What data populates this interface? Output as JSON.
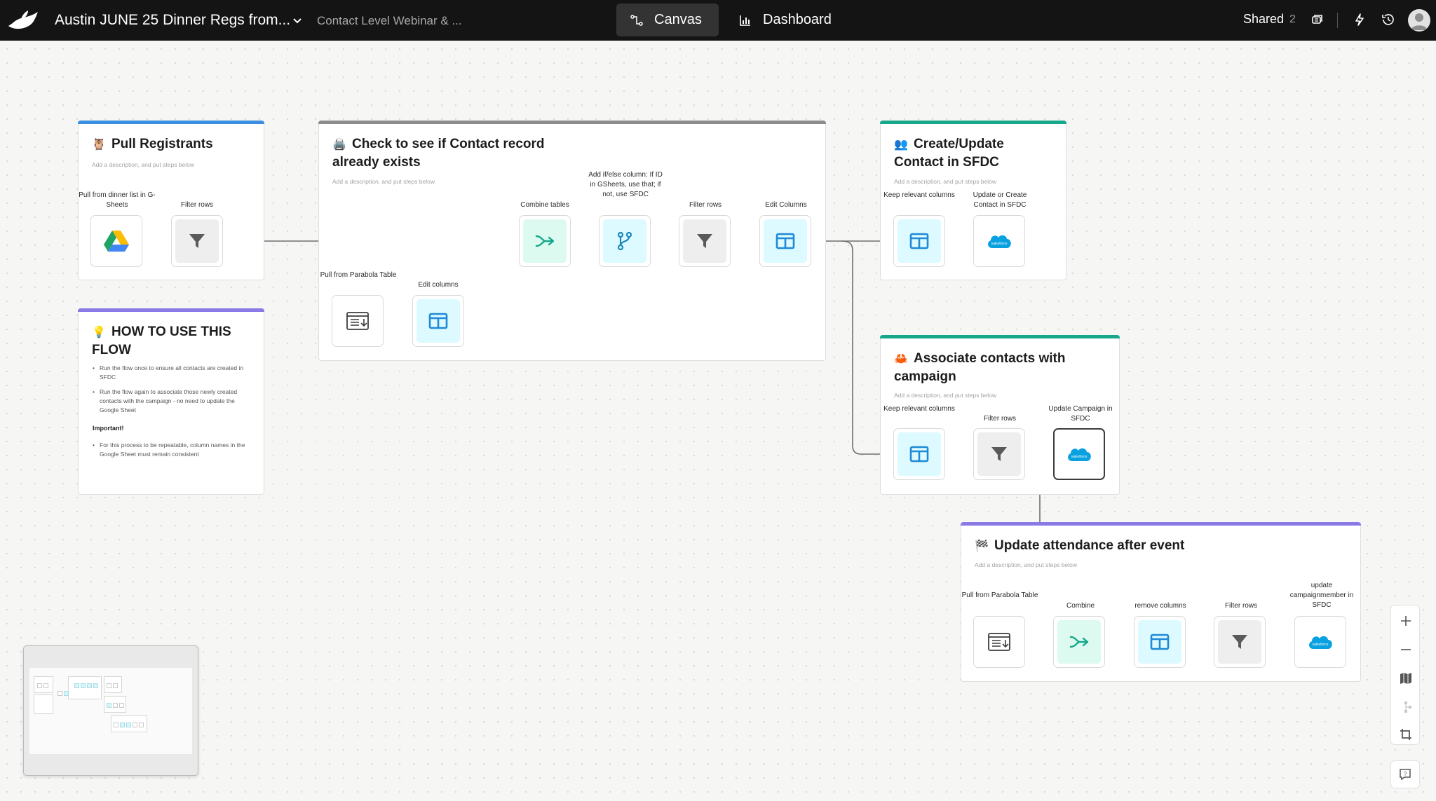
{
  "app": {
    "flow_title": "Austin JUNE 25 Dinner Regs from...",
    "flow_subtitle": "Contact Level Webinar & ...",
    "tabs": [
      {
        "label": "Canvas",
        "active": true
      },
      {
        "label": "Dashboard",
        "active": false
      }
    ],
    "shared_label": "Shared",
    "shared_count": "2",
    "colors": {
      "topbar": "#141414",
      "blue": "#3b8fe0",
      "purple": "#8a7ae6",
      "teal": "#17a88c",
      "gray": "#8c8c8c"
    }
  },
  "groups": {
    "pull": {
      "emoji": "🦉",
      "title": "Pull Registrants",
      "description": "Add a description, and put steps below",
      "steps": [
        "Pull from dinner list in G-Sheets",
        "Filter rows"
      ]
    },
    "howto": {
      "emoji": "💡",
      "title": "HOW TO USE THIS FLOW",
      "bullets": [
        "Run the flow once to ensure all contacts are created in SFDC",
        "Run the flow again to associate those newly created contacts with the campaign - no need to update the Google Sheet"
      ],
      "important_label": "Important!",
      "important_bullets": [
        "For this process to be repeatable, column names in the Google Sheet must remain consistent"
      ]
    },
    "check": {
      "emoji": "🖨️",
      "title": "Check to see if Contact record already exists",
      "description": "Add a description, and put steps below",
      "steps": [
        "Combine tables",
        "Add if/else column: If ID in GSheets, use that; if not, use SFDC",
        "Filter rows",
        "Edit Columns",
        "Pull from Parabola Table",
        "Edit columns"
      ]
    },
    "create": {
      "emoji": "👥",
      "title": "Create/Update Contact in SFDC",
      "description": "Add a description, and put steps below",
      "steps": [
        "Keep relevant columns",
        "Update or Create Contact in SFDC"
      ]
    },
    "associate": {
      "emoji": "🦀",
      "title": "Associate contacts with campaign",
      "description": "Add a description, and put steps below",
      "steps": [
        "Keep relevant columns",
        "Filter rows",
        "Update Campaign in SFDC"
      ]
    },
    "attendance": {
      "emoji": "🏁",
      "title": "Update attendance after event",
      "description": "Add a description, and put steps below",
      "steps": [
        "Pull from Parabola Table",
        "Combine",
        "remove columns",
        "Filter rows",
        "update campaignmember in SFDC"
      ]
    }
  },
  "icons": {
    "gsheets": "google-drive-icon",
    "filter": "filter-icon",
    "columns": "columns-icon",
    "combine": "combine-icon",
    "branch": "branch-icon",
    "table": "table-icon",
    "salesforce": "salesforce-icon"
  }
}
